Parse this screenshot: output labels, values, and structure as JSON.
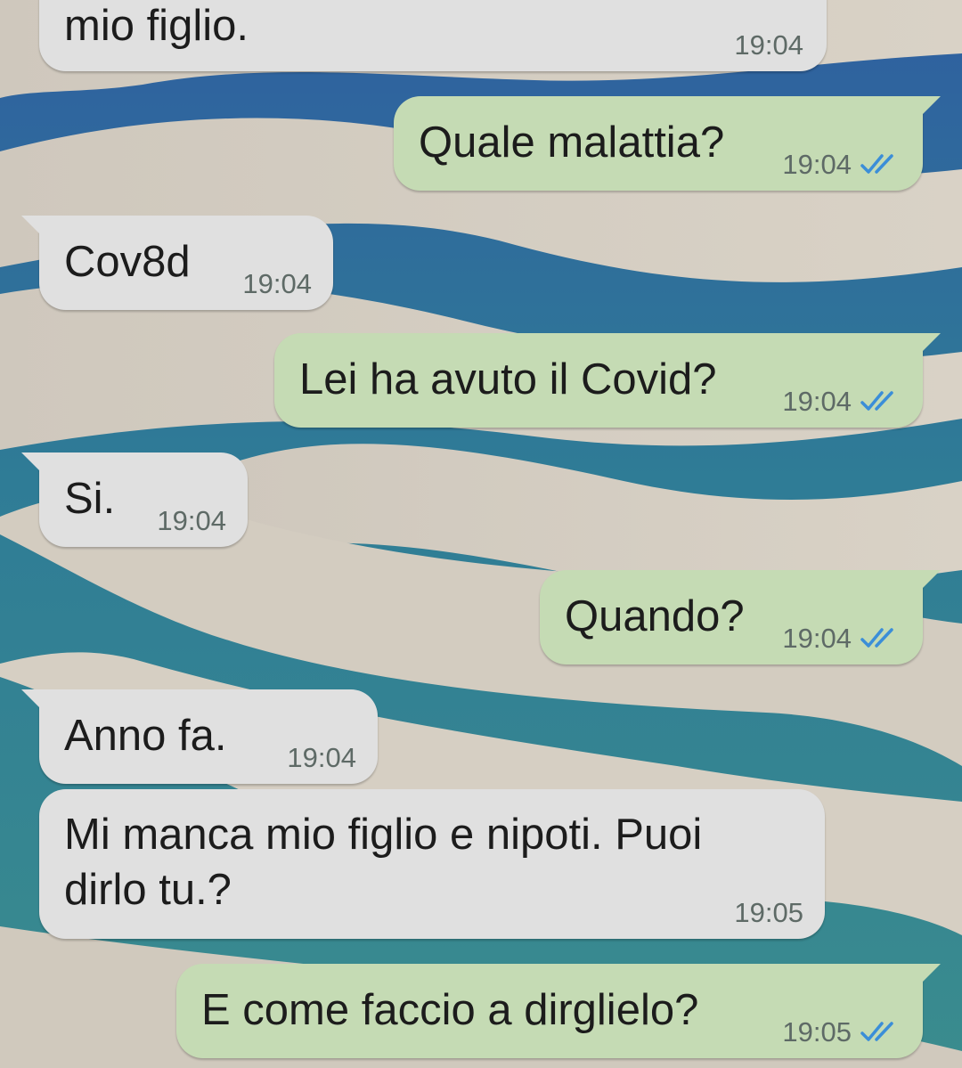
{
  "colors": {
    "incoming_bubble": "#e0e0e0",
    "outgoing_bubble": "#c5dbb4",
    "read_ticks": "#3b8ed8",
    "text": "#1c1c1c",
    "timestamp": "#5e6a66"
  },
  "messages": [
    {
      "direction": "incoming",
      "text": "mio figlio.",
      "time": "19:04"
    },
    {
      "direction": "outgoing",
      "text": "Quale malattia?",
      "time": "19:04",
      "status": "read-double-check-icon"
    },
    {
      "direction": "incoming",
      "text": "Cov8d",
      "time": "19:04"
    },
    {
      "direction": "outgoing",
      "text": "Lei ha avuto il Covid?",
      "time": "19:04",
      "status": "read-double-check-icon"
    },
    {
      "direction": "incoming",
      "text": "Si.",
      "time": "19:04"
    },
    {
      "direction": "outgoing",
      "text": "Quando?",
      "time": "19:04",
      "status": "read-double-check-icon"
    },
    {
      "direction": "incoming",
      "text": "Anno fa.",
      "time": "19:04"
    },
    {
      "direction": "incoming",
      "text_lines": [
        "Mi manca mio figlio e nipoti. Puoi",
        "dirlo tu.?"
      ],
      "time": "19:05"
    },
    {
      "direction": "outgoing",
      "text": "E come faccio a dirglielo?",
      "time": "19:05",
      "status": "read-double-check-icon"
    }
  ]
}
